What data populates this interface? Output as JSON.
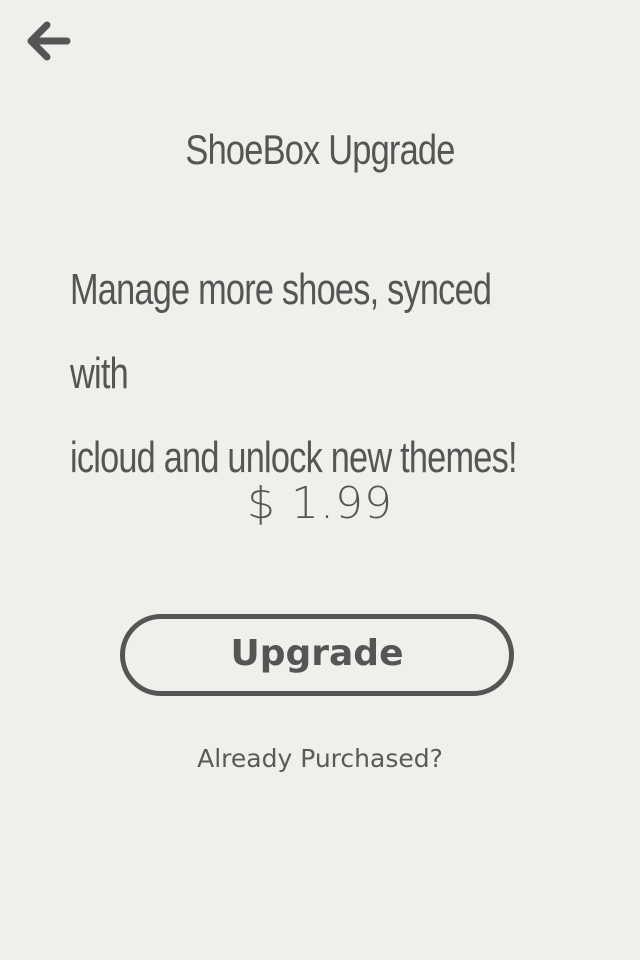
{
  "header": {
    "back_icon": "arrow-left-icon"
  },
  "upgrade": {
    "title": "ShoeBox Upgrade",
    "description_line1": "Manage more shoes, synced with",
    "description_line2": "icloud and unlock new themes!",
    "price": "$ 1.99",
    "button_label": "Upgrade",
    "restore_label": "Already Purchased?"
  },
  "colors": {
    "background": "#f0efeb",
    "text": "#555555"
  }
}
